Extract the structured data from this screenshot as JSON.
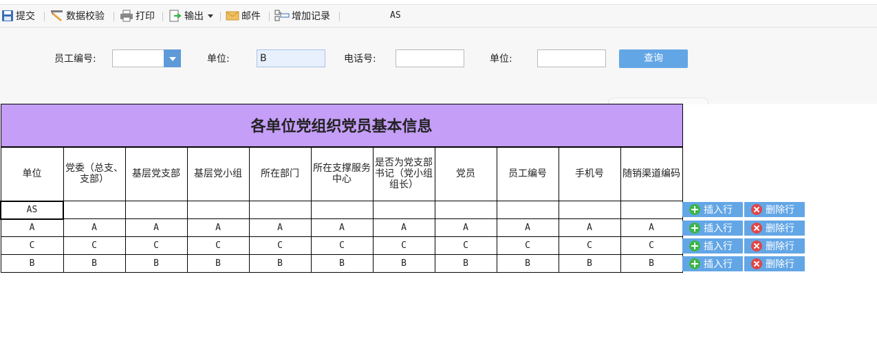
{
  "toolbar": {
    "submit": "提交",
    "validate": "数据校验",
    "print": "打印",
    "export": "输出",
    "mail": "邮件",
    "add_record": "增加记录",
    "right_text": "AS"
  },
  "filter": {
    "emp_no_label": "员工编号:",
    "emp_no_value": "",
    "unit_label": "单位:",
    "unit_value": "B",
    "phone_label": "电话号:",
    "phone_value": "",
    "unit2_label": "单位:",
    "unit2_value": "",
    "query_label": "查询"
  },
  "grid": {
    "title": "各单位党组织党员基本信息",
    "headers": [
      "单位",
      "党委（总支、支部）",
      "基层党支部",
      "基层党小组",
      "所在部门",
      "所在支撑服务中心",
      "是否为党支部书记（党小组组长）",
      "党员",
      "员工编号",
      "手机号",
      "随销渠道编码"
    ],
    "rows": [
      [
        "AS",
        "",
        "",
        "",
        "",
        "",
        "",
        "",
        "",
        "",
        ""
      ],
      [
        "A",
        "A",
        "A",
        "A",
        "A",
        "A",
        "A",
        "A",
        "A",
        "A",
        "A"
      ],
      [
        "C",
        "C",
        "C",
        "C",
        "C",
        "C",
        "C",
        "C",
        "C",
        "C",
        "C"
      ],
      [
        "B",
        "B",
        "B",
        "B",
        "B",
        "B",
        "B",
        "B",
        "B",
        "B",
        "B"
      ]
    ]
  },
  "row_actions": {
    "insert_label": "插入行",
    "delete_label": "删除行"
  },
  "colors": {
    "title_bg": "#c49ef7",
    "button_blue": "#63a6e6",
    "insert_icon": "#3bb54a",
    "delete_icon": "#e04646"
  }
}
